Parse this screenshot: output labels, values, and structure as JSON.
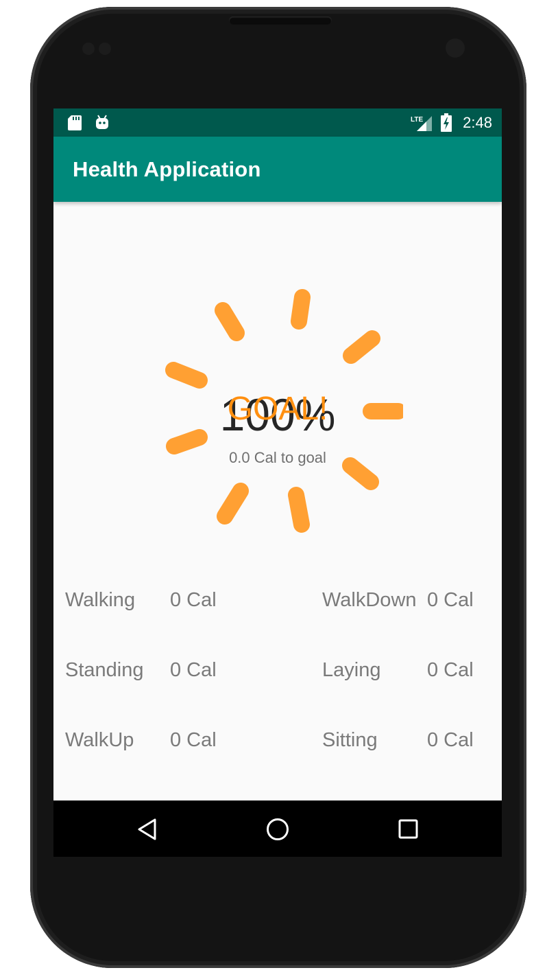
{
  "status_bar": {
    "time": "2:48",
    "network": "LTE",
    "icons": [
      "sd-card-icon",
      "android-icon",
      "lte-signal-icon",
      "battery-charging-icon"
    ]
  },
  "app_bar": {
    "title": "Health Application"
  },
  "progress": {
    "percent_text": "100%",
    "goal_text": "GOAL!",
    "remaining_text": "0.0 Cal to goal",
    "accent_color": "#ff9b2b"
  },
  "activities": [
    {
      "name": "Walking",
      "value": "0 Cal"
    },
    {
      "name": "WalkDown",
      "value": "0 Cal"
    },
    {
      "name": "Standing",
      "value": "0 Cal"
    },
    {
      "name": "Laying",
      "value": "0 Cal"
    },
    {
      "name": "WalkUp",
      "value": "0 Cal"
    },
    {
      "name": "Sitting",
      "value": "0 Cal"
    }
  ],
  "nav_bar": {
    "icons": [
      "back-icon",
      "home-icon",
      "recents-icon"
    ]
  },
  "colors": {
    "status_bar": "#00594d",
    "app_bar": "#00897b",
    "background": "#fafafa",
    "text_secondary": "#7a7a7a"
  }
}
